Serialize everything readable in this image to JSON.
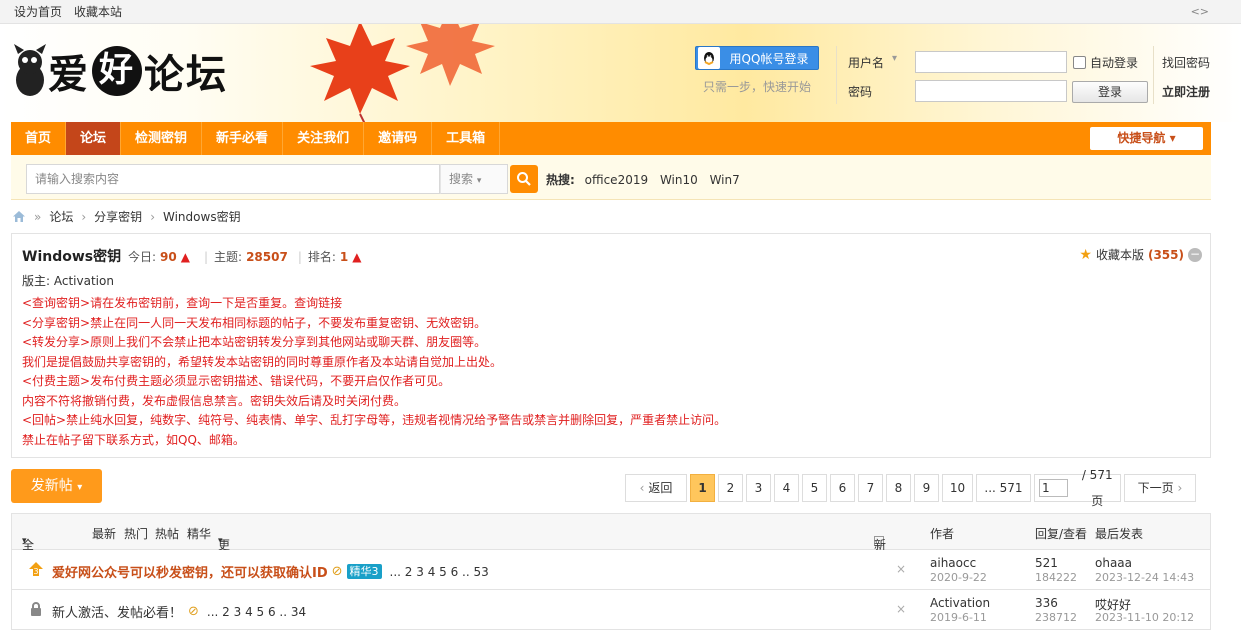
{
  "topbar": {
    "set_home": "设为首页",
    "bookmark": "收藏本站",
    "toggle": "<>"
  },
  "logo": {
    "c1": "爱",
    "c2": "好",
    "c3": "论坛"
  },
  "login": {
    "qq_button": "用QQ帐号登录",
    "qq_hint": "只需一步，快速开始",
    "username_label": "用户名",
    "password_label": "密码",
    "auto_login": "自动登录",
    "login_button": "登录",
    "find_password": "找回密码",
    "register": "立即注册"
  },
  "nav": {
    "items": [
      "首页",
      "论坛",
      "检测密钥",
      "新手必看",
      "关注我们",
      "邀请码",
      "工具箱"
    ],
    "quick_nav": "快捷导航"
  },
  "search": {
    "placeholder": "请输入搜索内容",
    "type": "搜索",
    "hot_label": "热搜:",
    "hot_terms": [
      "office2019",
      "Win10",
      "Win7"
    ]
  },
  "breadcrumb": [
    "论坛",
    "分享密钥",
    "Windows密钥"
  ],
  "forum": {
    "name": "Windows密钥",
    "today_label": "今日:",
    "today": "90",
    "topics_label": "主题:",
    "topics": "28507",
    "rank_label": "排名:",
    "rank": "1",
    "fav_label": "收藏本版",
    "fav_count": "(355)",
    "moderator": "版主: Activation",
    "rules": [
      "<查询密钥>请在发布密钥前，查询一下是否重复。查询链接",
      "<分享密钥>禁止在同一人同一天发布相同标题的帖子，不要发布重复密钥、无效密钥。",
      "<转发分享>原则上我们不会禁止把本站密钥转发分享到其他网站或聊天群、朋友圈等。",
      "我们是提倡鼓励共享密钥的，希望转发本站密钥的同时尊重原作者及本站请自觉加上出处。",
      "<付费主题>发布付费主题必须显示密钥描述、错误代码，不要开启仅作者可见。",
      "内容不符将撤销付费，发布虚假信息禁言。密钥失效后请及时关闭付费。",
      "<回帖>禁止纯水回复，纯数字、纯符号、纯表情、单字、乱打字母等，违规者视情况给予警告或禁言并删除回复，严重者禁止访问。",
      "禁止在帖子留下联系方式，如QQ、邮箱。"
    ]
  },
  "toolbar": {
    "new_post": "发新帖"
  },
  "pager": {
    "back": "返回",
    "pages": [
      "1",
      "2",
      "3",
      "4",
      "5",
      "6",
      "7",
      "8",
      "9",
      "10",
      "... 571"
    ],
    "current": "1",
    "input_value": "1",
    "total": "/ 571 页",
    "next": "下一页"
  },
  "threadlist": {
    "headers": {
      "all": "全部主题",
      "latest": "最新",
      "hot": "热门",
      "hot_posts": "热帖",
      "digest": "精华",
      "more": "更多",
      "new_window": "新窗",
      "author": "作者",
      "reply_view": "回复/查看",
      "last_post": "最后发表"
    },
    "rows": [
      {
        "title": "爱好网公众号可以秒发密钥，还可以获取确认ID",
        "tag": "精华3",
        "pages": "... 2  3  4  5  6 .. 53",
        "author": "aihaocc",
        "author_date": "2020-9-22",
        "replies": "521",
        "views": "184222",
        "last_user": "ohaaa",
        "last_date": "2023-12-24 14:43"
      },
      {
        "title": "新人激活、发帖必看！",
        "tag": "",
        "pages": "... 2  3  4  5  6 .. 34",
        "author": "Activation",
        "author_date": "2019-6-11",
        "replies": "336",
        "views": "238712",
        "last_user": "哎好好",
        "last_date": "2023-11-10 20:12"
      }
    ]
  },
  "colors": {
    "accent": "#ff8c00",
    "active_nav": "#c4461a",
    "rule_text": "#e02020",
    "number": "#c84f19"
  }
}
